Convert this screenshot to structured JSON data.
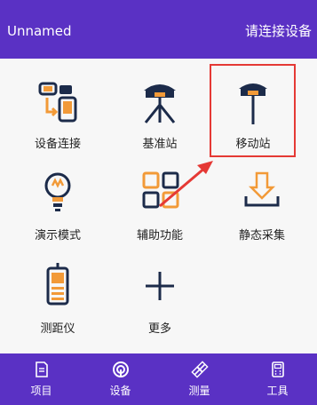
{
  "header": {
    "title": "Unnamed",
    "action_label": "请连接设备"
  },
  "tiles": [
    {
      "label": "设备连接",
      "icon": "device-connect-icon"
    },
    {
      "label": "基准站",
      "icon": "base-station-icon"
    },
    {
      "label": "移动站",
      "icon": "rover-station-icon"
    },
    {
      "label": "演示模式",
      "icon": "lightbulb-icon"
    },
    {
      "label": "辅助功能",
      "icon": "grid-tools-icon"
    },
    {
      "label": "静态采集",
      "icon": "download-icon"
    },
    {
      "label": "测距仪",
      "icon": "rangefinder-icon"
    },
    {
      "label": "更多",
      "icon": "plus-icon"
    }
  ],
  "bottom_nav": [
    {
      "label": "项目",
      "icon": "project-icon"
    },
    {
      "label": "设备",
      "icon": "device-icon",
      "active": true
    },
    {
      "label": "测量",
      "icon": "survey-icon"
    },
    {
      "label": "工具",
      "icon": "tools-icon"
    }
  ],
  "annotation": {
    "highlighted_tile": "移动站",
    "highlight_color": "#e53935"
  },
  "colors": {
    "primary": "#5a31c4",
    "icon_dark": "#1c2b4a",
    "icon_accent": "#f29a38"
  }
}
